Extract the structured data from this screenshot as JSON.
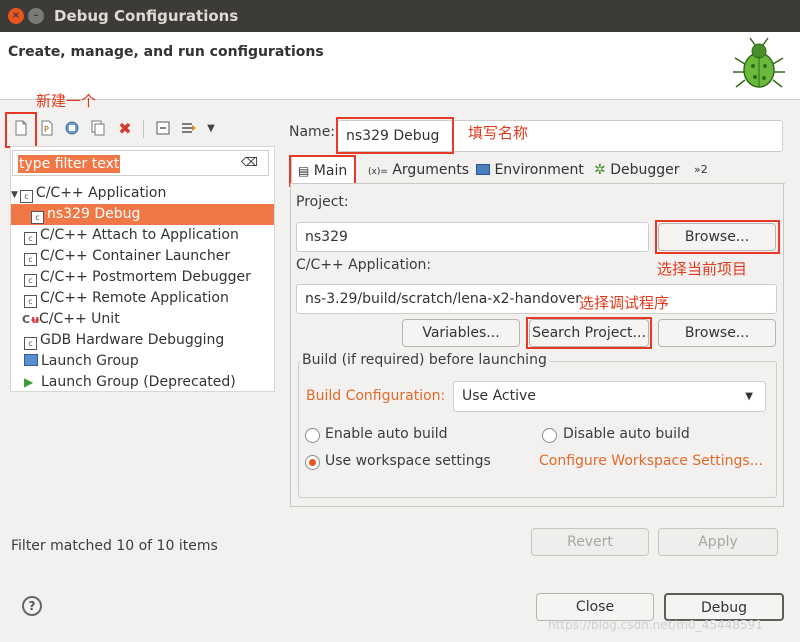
{
  "window": {
    "title": "Debug Configurations",
    "close_glyph": "×",
    "min_glyph": "–"
  },
  "header": {
    "title": "Create, manage, and run configurations",
    "logo_icon": "bug-icon"
  },
  "annotations": {
    "new": "新建一个",
    "name": "填写名称",
    "browse": "选择当前项目",
    "app": "选择调试程序"
  },
  "toolbar": {
    "icons": [
      "new-config-icon",
      "new-prototype-icon",
      "duplicate-icon",
      "copy-icon",
      "delete-icon",
      "collapse-all-icon",
      "filter-icon",
      "dropdown-icon"
    ]
  },
  "filter": {
    "placeholder": "type filter text",
    "clear_glyph": "⌫"
  },
  "tree": {
    "items": [
      {
        "label": "C/C++ Application",
        "icon": "c-app-icon",
        "expanded": true
      },
      {
        "label": "ns329 Debug",
        "icon": "c-app-icon",
        "selected": true
      },
      {
        "label": "C/C++ Attach to Application",
        "icon": "c-app-icon"
      },
      {
        "label": "C/C++ Container Launcher",
        "icon": "c-app-icon"
      },
      {
        "label": "C/C++ Postmortem Debugger",
        "icon": "c-app-icon"
      },
      {
        "label": "C/C++ Remote Application",
        "icon": "c-app-icon"
      },
      {
        "label": "C/C++ Unit",
        "icon": "cu-icon"
      },
      {
        "label": "GDB Hardware Debugging",
        "icon": "c-app-icon"
      },
      {
        "label": "Launch Group",
        "icon": "launch-group-icon"
      },
      {
        "label": "Launch Group (Deprecated)",
        "icon": "play-icon"
      }
    ],
    "status": "Filter matched 10 of 10 items"
  },
  "form": {
    "name_label": "Name:",
    "name_value": "ns329 Debug",
    "tabs": [
      "Main",
      "Arguments",
      "Environment",
      "Debugger",
      "»2"
    ],
    "project_label": "Project:",
    "project_value": "ns329",
    "browse_label": "Browse...",
    "app_label": "C/C++ Application:",
    "app_value": "ns-3.29/build/scratch/lena-x2-handover",
    "variables_label": "Variables...",
    "search_project_label": "Search Project...",
    "browse2_label": "Browse...",
    "build_group_label": "Build (if required) before launching",
    "build_config_label": "Build Configuration:",
    "build_config_value": "Use Active",
    "enable_auto": "Enable auto build",
    "disable_auto": "Disable auto build",
    "use_workspace": "Use workspace settings",
    "configure_link": "Configure Workspace Settings...",
    "revert_label": "Revert",
    "apply_label": "Apply"
  },
  "footer": {
    "close_label": "Close",
    "debug_label": "Debug",
    "help_glyph": "?",
    "watermark": "https://blog.csdn.net/m0_45448591"
  }
}
